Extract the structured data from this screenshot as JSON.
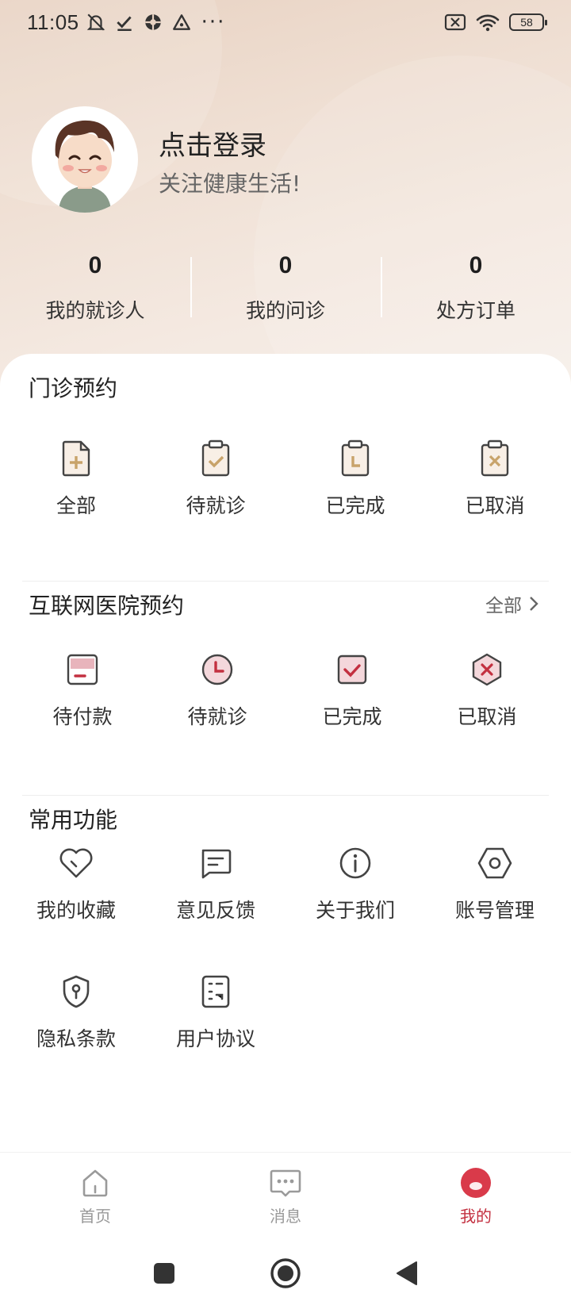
{
  "status_bar": {
    "time": "11:05",
    "more": "···",
    "battery": "58"
  },
  "profile": {
    "title": "点击登录",
    "subtitle": "关注健康生活!"
  },
  "stats": [
    {
      "value": "0",
      "label": "我的就诊人"
    },
    {
      "value": "0",
      "label": "我的问诊"
    },
    {
      "value": "0",
      "label": "处方订单"
    }
  ],
  "outpatient": {
    "title": "门诊预约",
    "items": [
      {
        "label": "全部",
        "icon": "doc-plus-icon"
      },
      {
        "label": "待就诊",
        "icon": "clipboard-check-icon"
      },
      {
        "label": "已完成",
        "icon": "clipboard-clock-icon"
      },
      {
        "label": "已取消",
        "icon": "clipboard-x-icon"
      }
    ]
  },
  "internet": {
    "title": "互联网医院预约",
    "more": "全部",
    "items": [
      {
        "label": "待付款",
        "icon": "card-minus-icon"
      },
      {
        "label": "待就诊",
        "icon": "clock-icon"
      },
      {
        "label": "已完成",
        "icon": "check-square-icon"
      },
      {
        "label": "已取消",
        "icon": "hexagon-x-icon"
      }
    ]
  },
  "common": {
    "title": "常用功能",
    "items": [
      {
        "label": "我的收藏",
        "icon": "heart-icon"
      },
      {
        "label": "意见反馈",
        "icon": "message-icon"
      },
      {
        "label": "关于我们",
        "icon": "info-icon"
      },
      {
        "label": "账号管理",
        "icon": "hex-settings-icon"
      },
      {
        "label": "隐私条款",
        "icon": "shield-lock-icon"
      },
      {
        "label": "用户协议",
        "icon": "agreement-icon"
      }
    ]
  },
  "tabbar": [
    {
      "label": "首页",
      "icon": "home-icon",
      "active": false
    },
    {
      "label": "消息",
      "icon": "chat-icon",
      "active": false
    },
    {
      "label": "我的",
      "icon": "user-dot-icon",
      "active": true
    }
  ],
  "colors": {
    "accent": "#c33040",
    "icon_gold": "#c8a36a",
    "icon_pink": "#e8b4bc"
  }
}
